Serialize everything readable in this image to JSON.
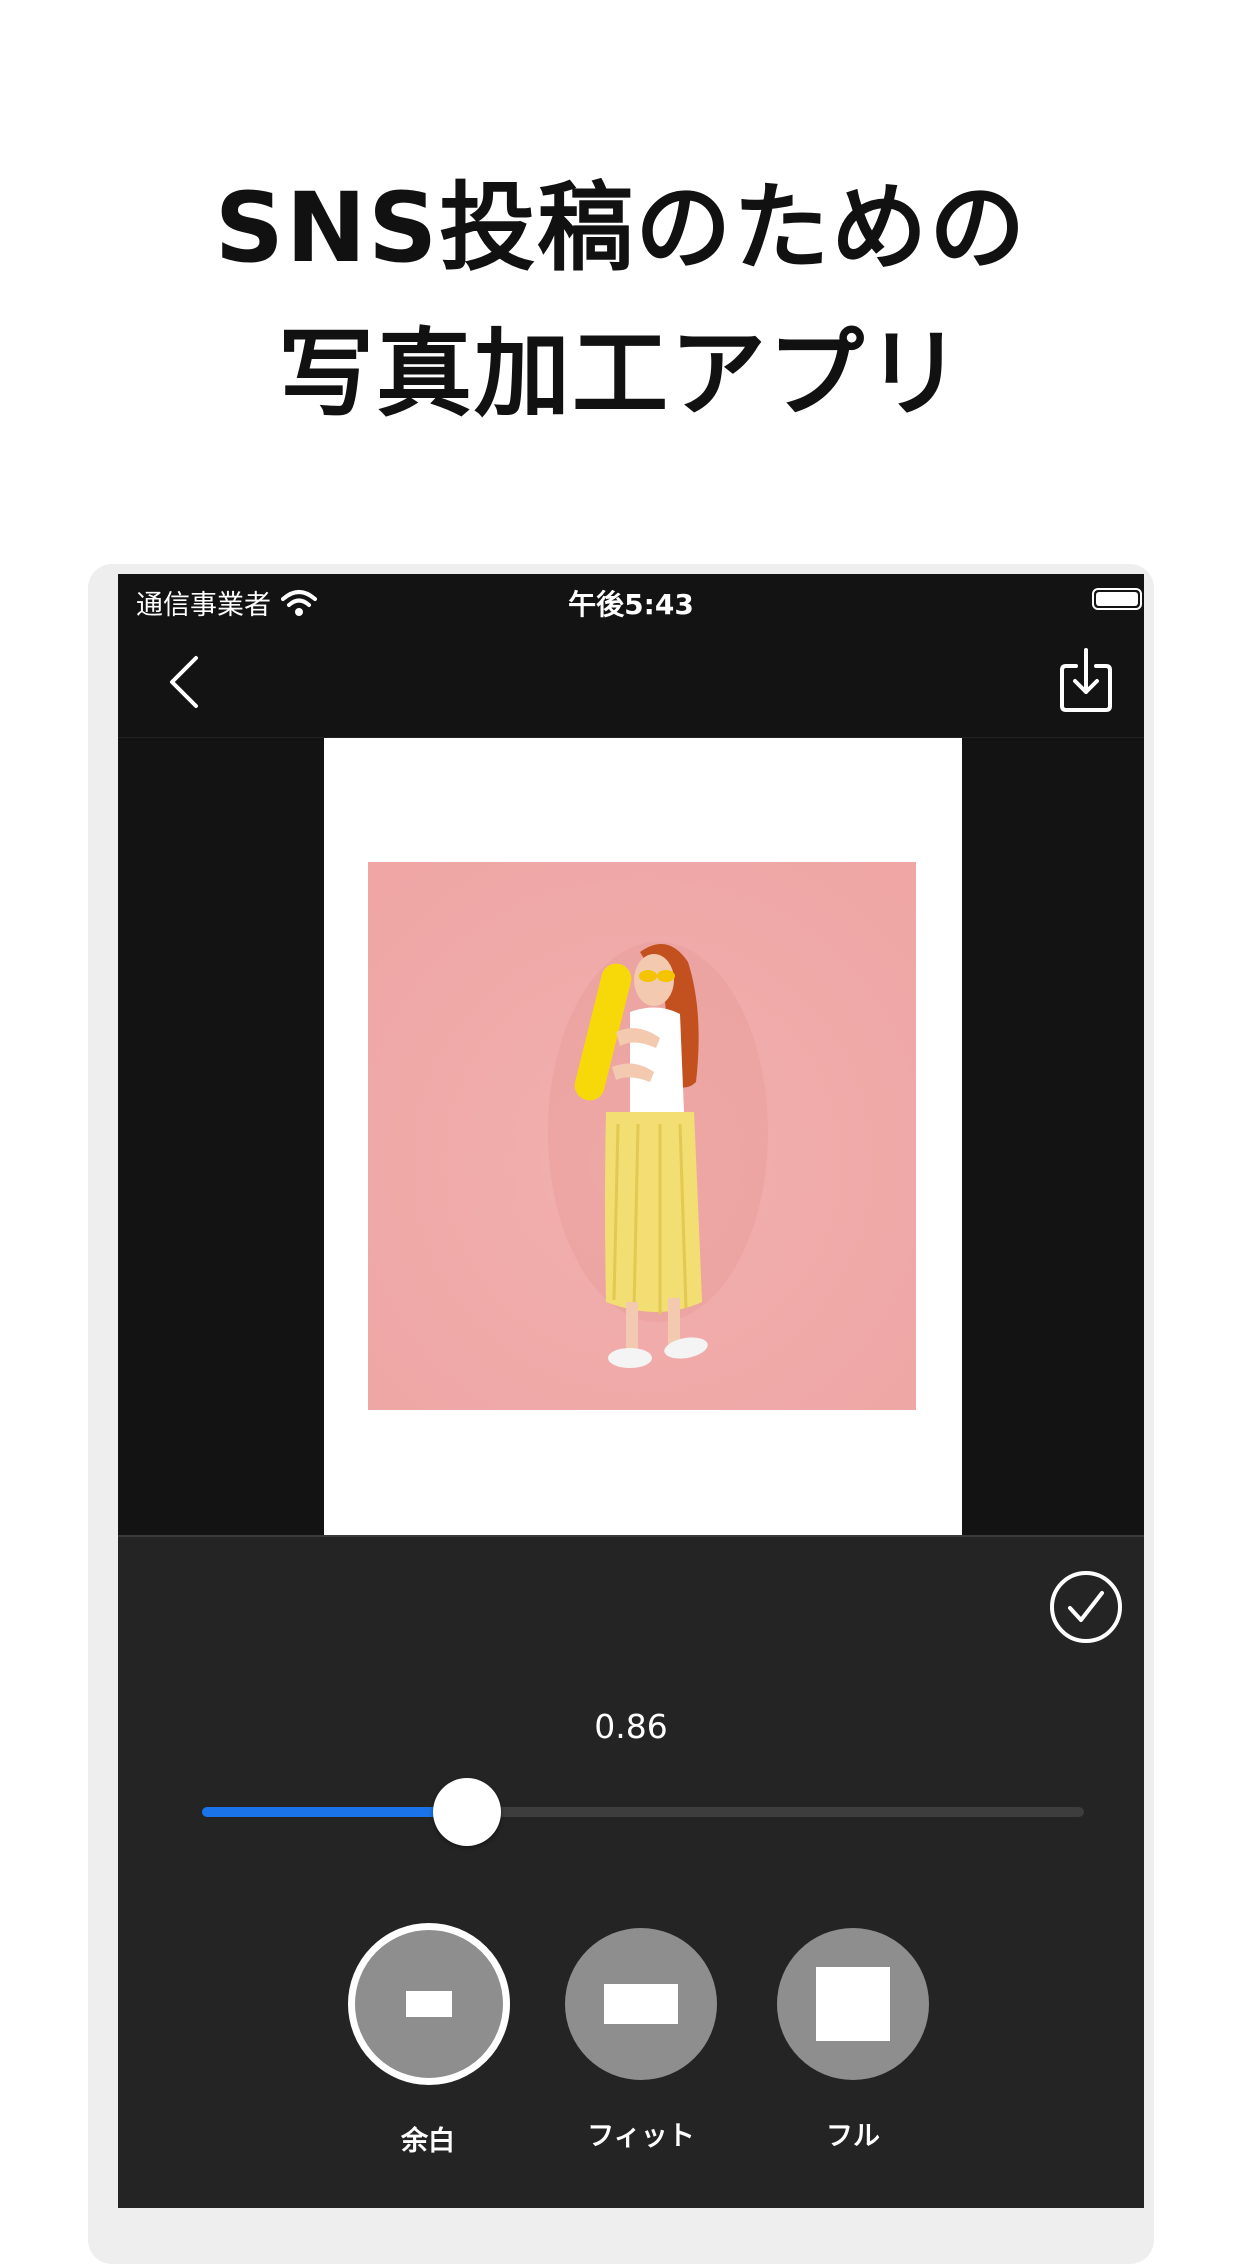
{
  "headline": {
    "line1": "SNS投稿のための",
    "line2": "写真加工アプリ"
  },
  "status_bar": {
    "carrier": "通信事業者",
    "time": "午後5:43",
    "wifi_icon": "wifi-icon",
    "battery_icon": "battery-icon"
  },
  "nav_bar": {
    "back_icon": "chevron-left-icon",
    "export_icon": "download-tray-icon"
  },
  "canvas": {
    "frame_color": "#ffffff",
    "photo_background": "#f2aeac",
    "photo_subject": "photo"
  },
  "editor": {
    "confirm_icon": "checkmark-circle-icon",
    "slider": {
      "value_label": "0.86",
      "fill_fraction": 0.3,
      "accent_color": "#1a73e8"
    },
    "modes": [
      {
        "label": "余白",
        "icon": "small-rectangle-icon",
        "selected": true
      },
      {
        "label": "フィット",
        "icon": "wide-rectangle-icon",
        "selected": false
      },
      {
        "label": "フル",
        "icon": "square-icon",
        "selected": false
      }
    ]
  }
}
